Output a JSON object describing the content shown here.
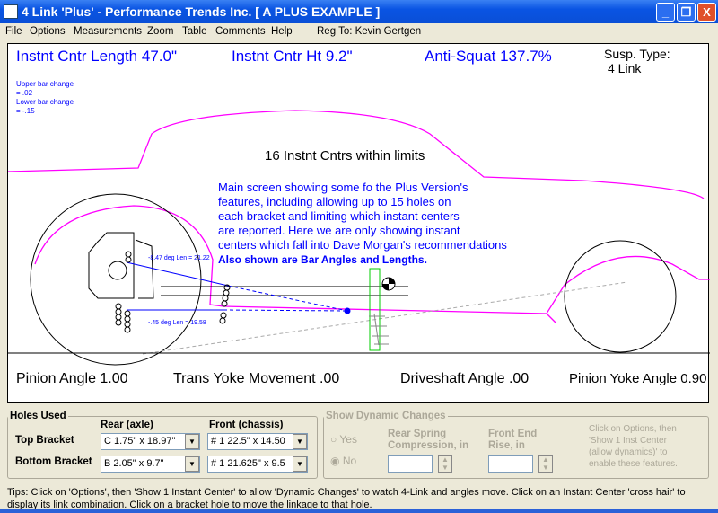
{
  "window": {
    "title": "4 Link 'Plus' - Performance Trends Inc.   [ A PLUS EXAMPLE ]",
    "minimize": "_",
    "maximize": "❐",
    "close": "X"
  },
  "menu": [
    "File",
    "Options",
    "Measurements",
    "Zoom",
    "Table",
    "Comments",
    "Help"
  ],
  "reg": "Reg To: Kevin Gertgen",
  "readouts": {
    "ic_length": "Instnt Cntr Length 47.0\"",
    "ic_height": "Instnt Cntr Ht  9.2\"",
    "anti_squat": "Anti-Squat  137.7%",
    "susp_label": "Susp. Type:",
    "susp_value": "4 Link"
  },
  "bar_change": {
    "upper": "Upper bar change",
    "upper_val": "= .02",
    "lower": "Lower bar change",
    "lower_val": "= -.15"
  },
  "ic_count": "16 Instnt Cntrs within limits",
  "description": [
    "Main screen showing some fo the Plus Version's",
    "features, including allowing up to 15 holes on",
    "each bracket and limiting which instant centers",
    "are reported.  Here we are only showing instant",
    "centers which fall into Dave Morgan's recommendations"
  ],
  "description_bold": "Also shown are Bar Angles and Lengths.",
  "bar_labels": {
    "upper": "-8.47 deg  Len = 21.22",
    "lower": "-.45 deg  Len = 19.58"
  },
  "bottom_readouts": {
    "pinion": "Pinion Angle  1.00",
    "yoke": "Trans Yoke Movement .00",
    "driveshaft": "Driveshaft Angle  .00",
    "pinion_yoke": "Pinion Yoke Angle  0.90"
  },
  "holes": {
    "legend": "Holes Used",
    "rear_header": "Rear (axle)",
    "front_header": "Front (chassis)",
    "top_label": "Top Bracket",
    "bottom_label": "Bottom Bracket",
    "top_rear": "C   1.75\" x 18.97\"",
    "top_front": "# 1   22.5\" x 14.50",
    "bottom_rear": "B   2.05\" x 9.7\"",
    "bottom_front": "# 1   21.625\" x 9.5"
  },
  "dynamic": {
    "legend": "Show Dynamic Changes",
    "yes": "Yes",
    "no": "No",
    "selected": "No",
    "rear_spring": "Rear Spring",
    "rear_spring2": "Compression, in",
    "front_end": "Front End",
    "front_end2": "Rise, in",
    "rear_value": "",
    "front_value": "",
    "note": [
      "Click on Options, then",
      "'Show 1 Inst Center",
      "(allow dynamics)' to",
      "enable these features."
    ]
  },
  "tips": "Tips:  Click on 'Options', then 'Show 1 Instant Center' to allow 'Dynamic Changes' to watch 4-Link and angles move.  Click on an Instant Center 'cross hair' to display its link combination.  Click on a bracket hole to move the linkage to that hole.",
  "colors": {
    "car": "#ff00ff",
    "links": "#0000ff",
    "ic_box": "#00cc00"
  }
}
